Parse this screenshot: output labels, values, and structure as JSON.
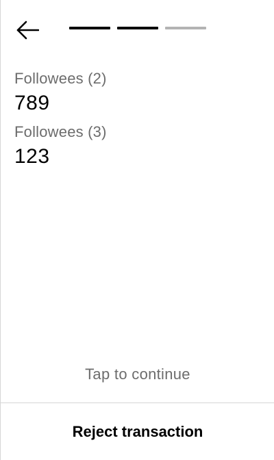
{
  "header": {
    "back_icon": "arrow-left-icon",
    "progress": {
      "total_steps": 3,
      "completed_steps": 2,
      "active_color": "#000000",
      "inactive_color": "#b3b3b3"
    }
  },
  "fields": [
    {
      "label": "Followees (2)",
      "value": "789"
    },
    {
      "label": "Followees (3)",
      "value": "123"
    }
  ],
  "hint": "Tap to continue",
  "footer": {
    "reject_label": "Reject transaction"
  }
}
